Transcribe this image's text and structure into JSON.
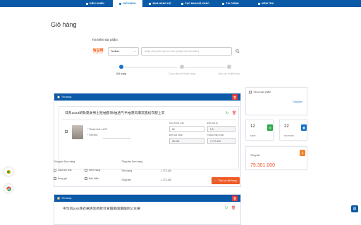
{
  "nav": {
    "items": [
      {
        "label": "ĐIỀU KHIỂN",
        "icon": "dashboard-icon"
      },
      {
        "label": "GIỎ HÀNG",
        "icon": "cart-icon"
      },
      {
        "label": "MUA HÀNG HỘ",
        "icon": "bag-icon"
      },
      {
        "label": "TẠO MUA HỘ KHÁC",
        "icon": "plus-icon"
      },
      {
        "label": "TÀI CHÍNH",
        "icon": "finance-icon"
      },
      {
        "label": "KIỂM TRA",
        "icon": "check-icon"
      }
    ],
    "active_index": 1,
    "active_color": "#1a73c8",
    "bar_color": "#0b5aa8"
  },
  "page": {
    "title": "Giỏ hàng"
  },
  "search": {
    "label": "Tìm kiếm sản phẩm",
    "logo_text": "淘宝网",
    "logo_sub": "TAOBAO.COM",
    "source_value": "TaoBao",
    "placeholder": "Nhập sản phẩm cần tìm kiếm (Nhập link sản phẩm)"
  },
  "steps": [
    {
      "label": "Giỏ hàng",
      "active": true
    },
    {
      "label": "Chọn địa chỉ nhận hàng",
      "active": false
    },
    {
      "label": "Đặt cọc và kết thúc",
      "active": false
    }
  ],
  "shop": {
    "header_label": "Tên shop:",
    "item_title": "日系2023新款夏季男士短袖圆领t恤透气半袖港风潮流宽松衣服上衣",
    "property_label": "* Thuộc tính:",
    "property_value": "LAYF",
    "note_label": "* Ghi chú:",
    "qty_label": "SỐ LƯỢNG (CÁI)",
    "qty_value": "60",
    "price_label": "ĐƠN GIÁ (¥)",
    "price_value": "9.9",
    "unit_vnd_label": "ĐƠN GIÁ (VNĐ)",
    "unit_vnd_value": "35.442",
    "total_vnd_label": "THÀNH TIỀN (VNĐ)",
    "total_vnd_value": "1.772.100"
  },
  "order_info": {
    "section_label": "Thông tin Đơn hàng",
    "checks": [
      "Giao tận nhà",
      "Kiểm hàng",
      "Đóng gỗ",
      "Bảo hiểm"
    ],
    "totals_label": "Tổng tiền Đơn hàng",
    "goods_label": "Tiền hàng",
    "goods_value": "1.772.100",
    "sum_label": "Tổng tiền",
    "sum_value": "1.772.100",
    "order_button": "Tiếp tục đặt hàng"
  },
  "shop2": {
    "header_label": "Tên shop:",
    "item_title": "中华风polo连衣裙清装新款可爱甜美国潮国风公主裙"
  },
  "sidebar": {
    "all_label": "Tất cả sản phẩm",
    "total_label": "Tổng tiền",
    "shop_count": "12",
    "shop_label": "SHOP",
    "product_count": "22",
    "product_label": "SẢN PHẨM",
    "grand_label": "Tổng tiền",
    "grand_value": "79.301.000",
    "grand_color": "#e8542a"
  }
}
